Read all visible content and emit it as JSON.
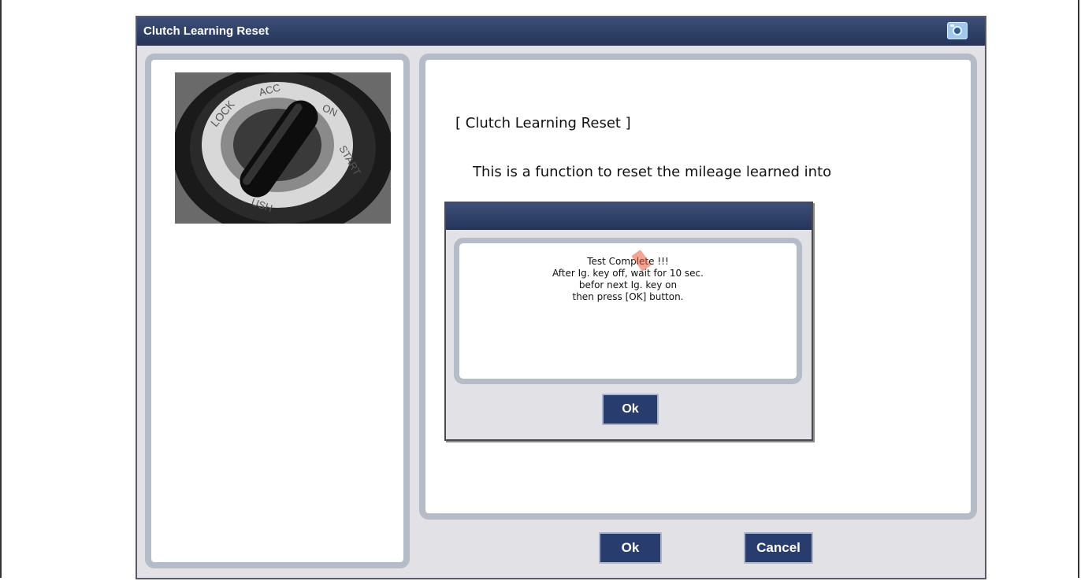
{
  "window": {
    "title": "Clutch Learning Reset",
    "camera_icon": "camera-icon"
  },
  "content": {
    "heading": "[ Clutch Learning Reset ]",
    "description": "This is a function to reset the  mileage learned into"
  },
  "dialog": {
    "message_lines": [
      "Test Complete !!!",
      "After Ig. key off, wait for 10 sec.",
      "befor next Ig. key on",
      "then press [OK] button."
    ],
    "ok_label": "Ok"
  },
  "buttons": {
    "ok_label": "Ok",
    "cancel_label": "Cancel"
  },
  "colors": {
    "titlebar": "#2c3c64",
    "button": "#283c6e",
    "panel_border": "#b6bbc8",
    "window_bg": "#e2e2e6"
  }
}
